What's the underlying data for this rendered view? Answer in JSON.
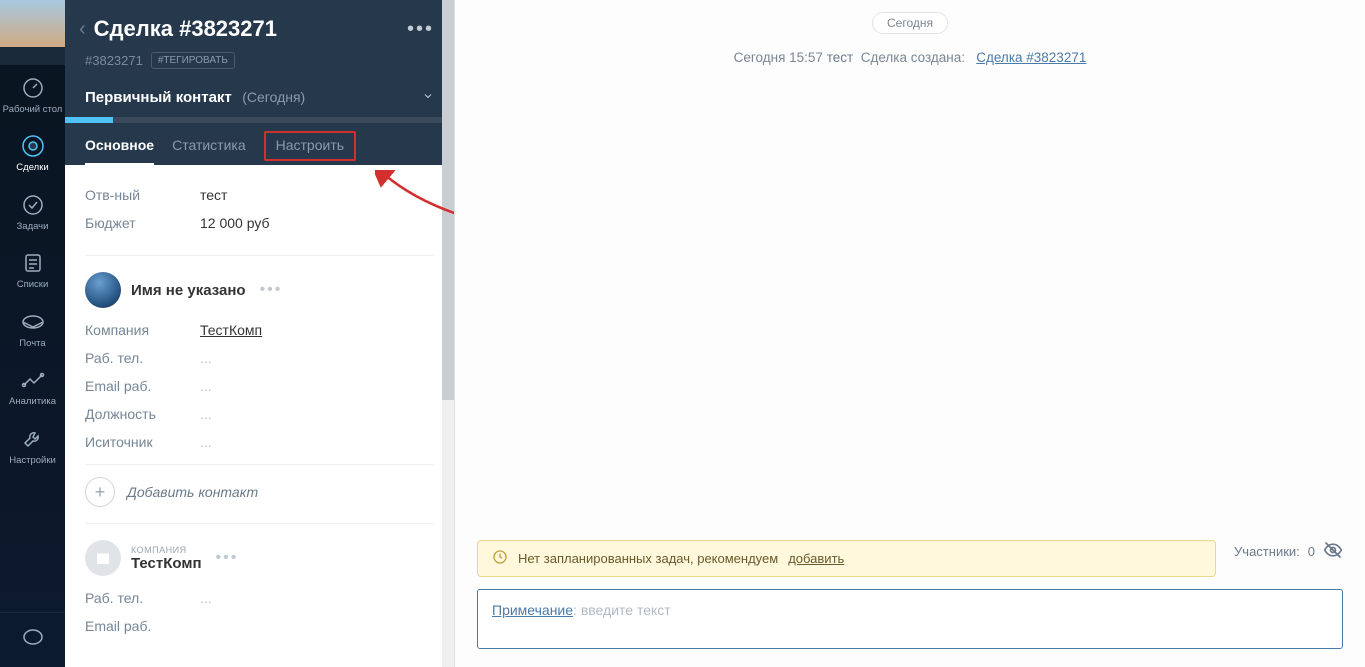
{
  "nav": {
    "items": [
      {
        "label": "Рабочий стол"
      },
      {
        "label": "Сделки"
      },
      {
        "label": "Задачи"
      },
      {
        "label": "Списки"
      },
      {
        "label": "Почта"
      },
      {
        "label": "Аналитика"
      },
      {
        "label": "Настройки"
      }
    ]
  },
  "deal": {
    "title": "Сделка #3823271",
    "id_tag": "#3823271",
    "tag_button": "#ТЕГИРОВАТЬ",
    "stage_name": "Первичный контакт",
    "stage_date": "(Сегодня)",
    "tabs": {
      "main": "Основное",
      "stats": "Статистика",
      "configure": "Настроить"
    },
    "fields": {
      "responsible_label": "Отв-ный",
      "responsible_value": "тест",
      "budget_label": "Бюджет",
      "budget_value": "12 000  руб"
    }
  },
  "contact": {
    "name": "Имя не указано",
    "fields": {
      "company_label": "Компания",
      "company_value": "ТестКомп",
      "work_phone_label": "Раб. тел.",
      "work_phone_value": "...",
      "work_email_label": "Email раб.",
      "work_email_value": "...",
      "position_label": "Должность",
      "position_value": "...",
      "source_label": "Иситочник",
      "source_value": "..."
    },
    "add_label": "Добавить контакт"
  },
  "company": {
    "label_small": "КОМПАНИЯ",
    "name": "ТестКомп",
    "work_phone_label": "Раб. тел.",
    "work_phone_value": "...",
    "work_email_label": "Email раб."
  },
  "feed": {
    "day_chip": "Сегодня",
    "time": "Сегодня 15:57",
    "user": "тест",
    "created_text": "Сделка создана:",
    "deal_link": "Сделка #3823271",
    "task_notice": "Нет запланированных задач, рекомендуем",
    "task_add_link": "добавить",
    "participants_label": "Участники:",
    "participants_count": "0",
    "note_label": "Примечание",
    "note_placeholder": ": введите текст"
  }
}
